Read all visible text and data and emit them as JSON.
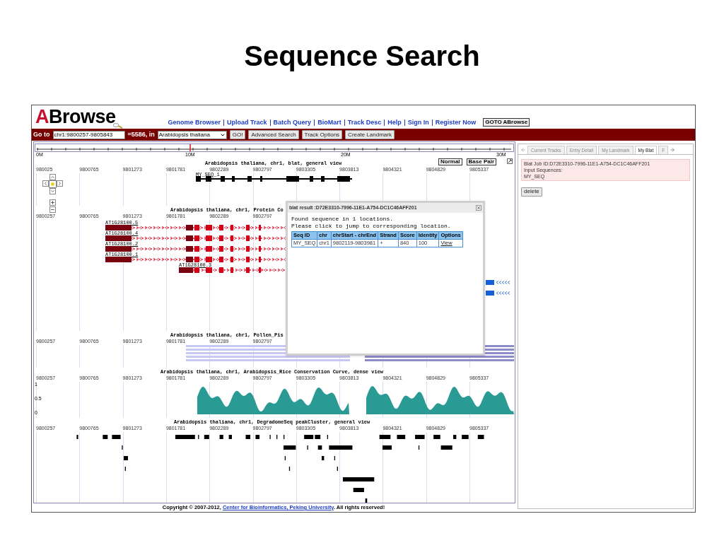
{
  "page_title": "Sequence Search",
  "app": {
    "logo": {
      "first": "A",
      "rest": "Browse"
    },
    "nav_links": [
      "Genome Browser",
      "Upload Track",
      "Batch Query",
      "BioMart",
      "Track Desc",
      "Help",
      "Sign In",
      "Register Now"
    ],
    "goto_button": "GOTO ABrowse"
  },
  "toolbar": {
    "goto_label": "Go to",
    "location": "chr1:9800257-9805843",
    "length_text": "=5586, in",
    "species": "Arabidopsis thaliana",
    "buttons": [
      "GO!",
      "Advanced Search",
      "Track Options",
      "Create Landmark"
    ]
  },
  "ruler": {
    "labels": [
      "0M",
      "10M",
      "20M",
      "30M"
    ]
  },
  "view_buttons": [
    "Normal",
    "Base Pair"
  ],
  "tracks": [
    {
      "kind": "blat",
      "title": "Arabidopsis thaliana, chr1, blat, general view",
      "axis_labels": [
        "980025",
        "9800765",
        "9801273",
        "9801781",
        "9802289",
        "9802797",
        "9803305",
        "9803813",
        "9804321",
        "9804829",
        "9805337"
      ],
      "feature_labels": [
        "MY_SEQ_1"
      ]
    },
    {
      "kind": "genes",
      "title": "Arabidopsis thaliana, chr1, Protein Co",
      "axis_labels": [
        "9800257",
        "9800765",
        "9801273",
        "9801781",
        "9802289",
        "9802797"
      ],
      "feature_labels": [
        "AT1G28100.5",
        "AT1G28100.4",
        "AT1G28100.2",
        "AT1G28100.1",
        "AT1G28100.3"
      ]
    },
    {
      "kind": "bars",
      "title": "Arabidopsis thaliana, chr1, Pollen_Pis",
      "axis_labels": [
        "9800257",
        "9800765",
        "9801273",
        "9801781",
        "9802289",
        "9802797"
      ]
    },
    {
      "kind": "curve",
      "title": "Arabidopsis thaliana, chr1, Arabidopsis_Rice Conservation Curve, dense view",
      "axis_labels": [
        "9800257",
        "9800765",
        "9801273",
        "9801781",
        "9802289",
        "9802797",
        "9803305",
        "9803813",
        "9804321",
        "9804829",
        "9805337"
      ],
      "y_labels": [
        "1",
        "0.5",
        "0"
      ]
    },
    {
      "kind": "peaks",
      "title": "Arabidopsis thaliana, chr1, DegradomeSeq peakCluster, general view",
      "axis_labels": [
        "9800257",
        "9800765",
        "9801273",
        "9801781",
        "9802289",
        "9802797",
        "9803305",
        "9803813",
        "9804321",
        "9804829",
        "9805337"
      ]
    }
  ],
  "blat_popup": {
    "title": "blat result :D72E3310-7996-11E1-A754-DC1C46AFF201",
    "message_lines": [
      "Found sequence in 1 locations.",
      "Please click to jump to corresponding location."
    ],
    "table": {
      "columns": [
        "Seq ID",
        "chr",
        "chrStart - chrEnd",
        "Strand",
        "Score",
        "Identity",
        "Options"
      ],
      "rows": [
        [
          "MY_SEQ",
          "chr1",
          "9802119-9803981",
          "+",
          "840",
          "100",
          "View"
        ]
      ]
    }
  },
  "side_panel": {
    "tabs": [
      {
        "label": "Current Tracks",
        "selected": false
      },
      {
        "label": "Entry Detail",
        "selected": false
      },
      {
        "label": "My Landmark",
        "selected": false
      },
      {
        "label": "My Blat",
        "selected": true
      },
      {
        "label": "F",
        "selected": false
      }
    ],
    "job_id": "Blat Job ID:D72E3310-7996-11E1-A754-DC1C46AFF201",
    "input_label": "Input Sequences:",
    "sequence": "MY_SEQ",
    "delete_button": "delete"
  },
  "footer": {
    "text": "Copyright © 2007-2012, ",
    "link": "Center for Bioinformatics, Peking University",
    "suffix": ". All rights reserved!"
  }
}
